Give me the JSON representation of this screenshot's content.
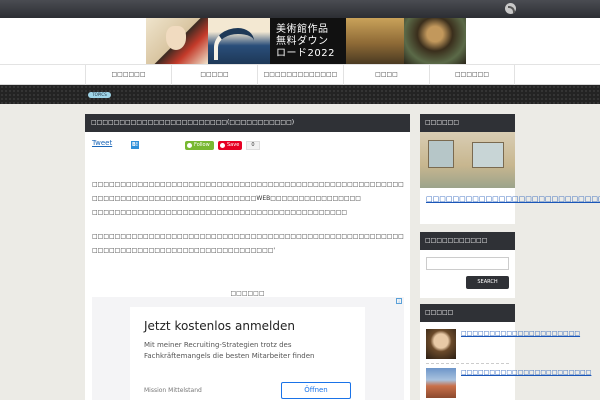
{
  "header": {
    "banner_text_line1": "美術館作品",
    "banner_text_line2": "無料ダウン",
    "banner_text_line3": "ロード2022"
  },
  "nav": {
    "items": [
      {
        "label": "□□□□□□"
      },
      {
        "label": "□□□□□"
      },
      {
        "label": "□□□□□□□□□□□□□"
      },
      {
        "label": "□□□□"
      },
      {
        "label": "□□□□□□"
      }
    ]
  },
  "topic": {
    "badge": "TOPICS"
  },
  "post": {
    "title": "□□□□□□□□□□□□□□□□□□□□□□□□(□□□□□□□□□□□)",
    "tweet_label": "Tweet",
    "hatena_label": "B!",
    "follow_label": "Follow",
    "save_label": "Save",
    "save_count": "0",
    "paragraph1": "□□□□□□□□□□□□□□□□□□□□□□□□□□□□□□□□□□□□□□□□□□□□□□□□□□□□□□□□□□□□□□□□□□□□□□□□□□□□□□□□□□□□WEB□□□□□□□□□□□□□□□□",
    "paragraph2": "□□□□□□□□□□□□□□□□□□□□□□□□□□□□□□□□□□□□□□□□□□□□□",
    "paragraph3": "□□□□□□□□□□□□□□□□□□□□□□□□□□□□□□□□□□□□□□□□□□□□□□□□□□□□□□□□□□□□□□□□□□□□□□□□□□□□□□□□□□□□□□□'"
  },
  "ad": {
    "label": "□□□□□□",
    "headline": "Jetzt kostenlos anmelden",
    "subtext": "Mit meiner Recruiting-Strategien trotz des Fachkräftemangels die besten Mitarbeiter finden",
    "advertiser": "Mission Mittelstand",
    "cta": "Öffnen"
  },
  "sidebar": {
    "box1": {
      "heading": "□□□□□□",
      "link": "□□□□□□□□□□□□□□□□□□□□□□□□□□□"
    },
    "box2": {
      "heading": "□□□□□□□□□□□",
      "search_button": "SEARCH"
    },
    "box3": {
      "heading": "□□□□□",
      "items": [
        {
          "label": "□□□□□□□□□□□□□□□□□□□□□"
        },
        {
          "label": "□□□□□□□□□□□□□□□□□□□□□□□"
        }
      ]
    }
  }
}
